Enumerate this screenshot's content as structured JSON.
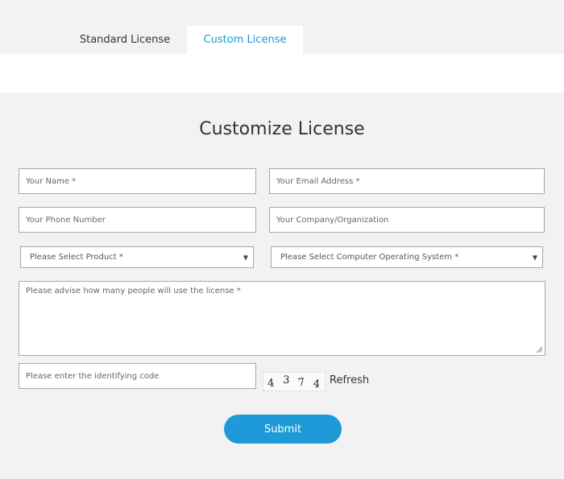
{
  "tabs": [
    {
      "label": "Standard License",
      "active": false
    },
    {
      "label": "Custom License",
      "active": true
    }
  ],
  "form": {
    "title": "Customize License",
    "name_placeholder": "Your Name *",
    "email_placeholder": "Your Email Address *",
    "phone_placeholder": "Your Phone Number",
    "company_placeholder": "Your Company/Organization",
    "product_select": "Please Select Product *",
    "os_select": "Please Select Computer Operating System *",
    "usage_placeholder": "Please advise how many people will use the license *",
    "code_placeholder": "Please enter the identifying code",
    "captcha_digits": [
      "4",
      "3",
      "7",
      "4"
    ],
    "refresh_label": "Refresh",
    "submit_label": "Submit"
  },
  "colors": {
    "accent": "#1f9ad8",
    "active_tab_text": "#1a9ad6",
    "background": "#f2f2f2"
  }
}
